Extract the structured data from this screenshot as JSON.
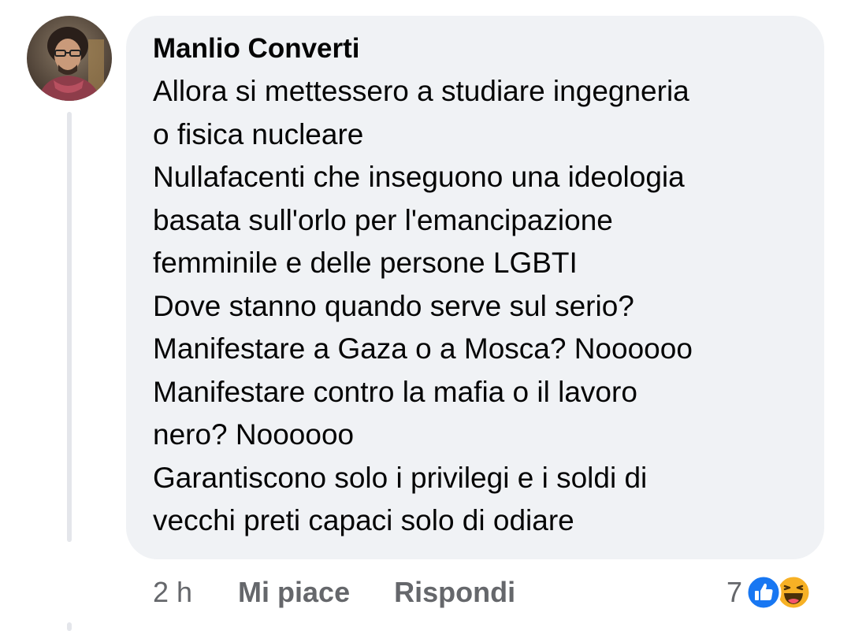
{
  "comment": {
    "author": "Manlio Converti",
    "text_lines": [
      "Allora si mettessero a studiare ingegneria",
      "o fisica nucleare",
      "Nullafacenti che inseguono una ideologia",
      "basata sull'orlo per l'emancipazione",
      "femminile e delle persone LGBTI",
      "Dove stanno quando serve sul serio?",
      "Manifestare a Gaza o a Mosca? Noooooo",
      "Manifestare contro la mafia o il lavoro",
      "nero? Noooooo",
      "Garantiscono solo i privilegi e i soldi di",
      "vecchi preti capaci solo di odiare"
    ],
    "timestamp": "2 h",
    "actions": {
      "like_label": "Mi piace",
      "reply_label": "Rispondi"
    },
    "reactions": {
      "count": "7",
      "icons": [
        "like-icon",
        "haha-icon"
      ]
    }
  },
  "colors": {
    "bubble_background": "#f0f2f5",
    "text": "#050505",
    "secondary_text": "#65676b",
    "like_blue": "#1877f2",
    "haha_yellow": "#f7b125"
  }
}
